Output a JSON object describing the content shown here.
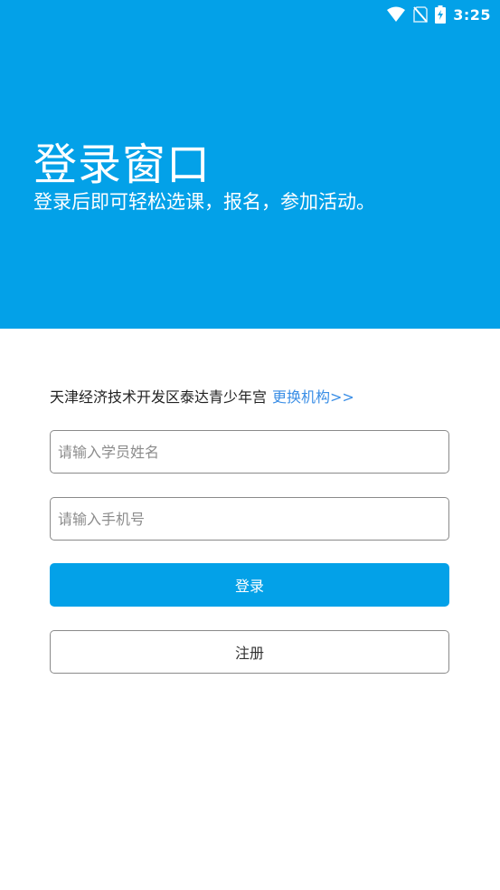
{
  "status_bar": {
    "time": "3:25",
    "icons": [
      "wifi-icon",
      "no-sim-icon",
      "battery-charging-icon"
    ]
  },
  "header": {
    "title": "登录窗口",
    "subtitle": "登录后即可轻松选课，报名，参加活动。",
    "background_color": "#03a1e8"
  },
  "organization": {
    "name": "天津经济技术开发区泰达青少年宫",
    "change_link": "更换机构>>",
    "link_color": "#3a8ee6"
  },
  "form": {
    "name_field": {
      "value": "",
      "placeholder": "请输入学员姓名"
    },
    "phone_field": {
      "value": "",
      "placeholder": "请输入手机号"
    },
    "login_label": "登录",
    "register_label": "注册",
    "accent_color": "#03a1e8"
  }
}
